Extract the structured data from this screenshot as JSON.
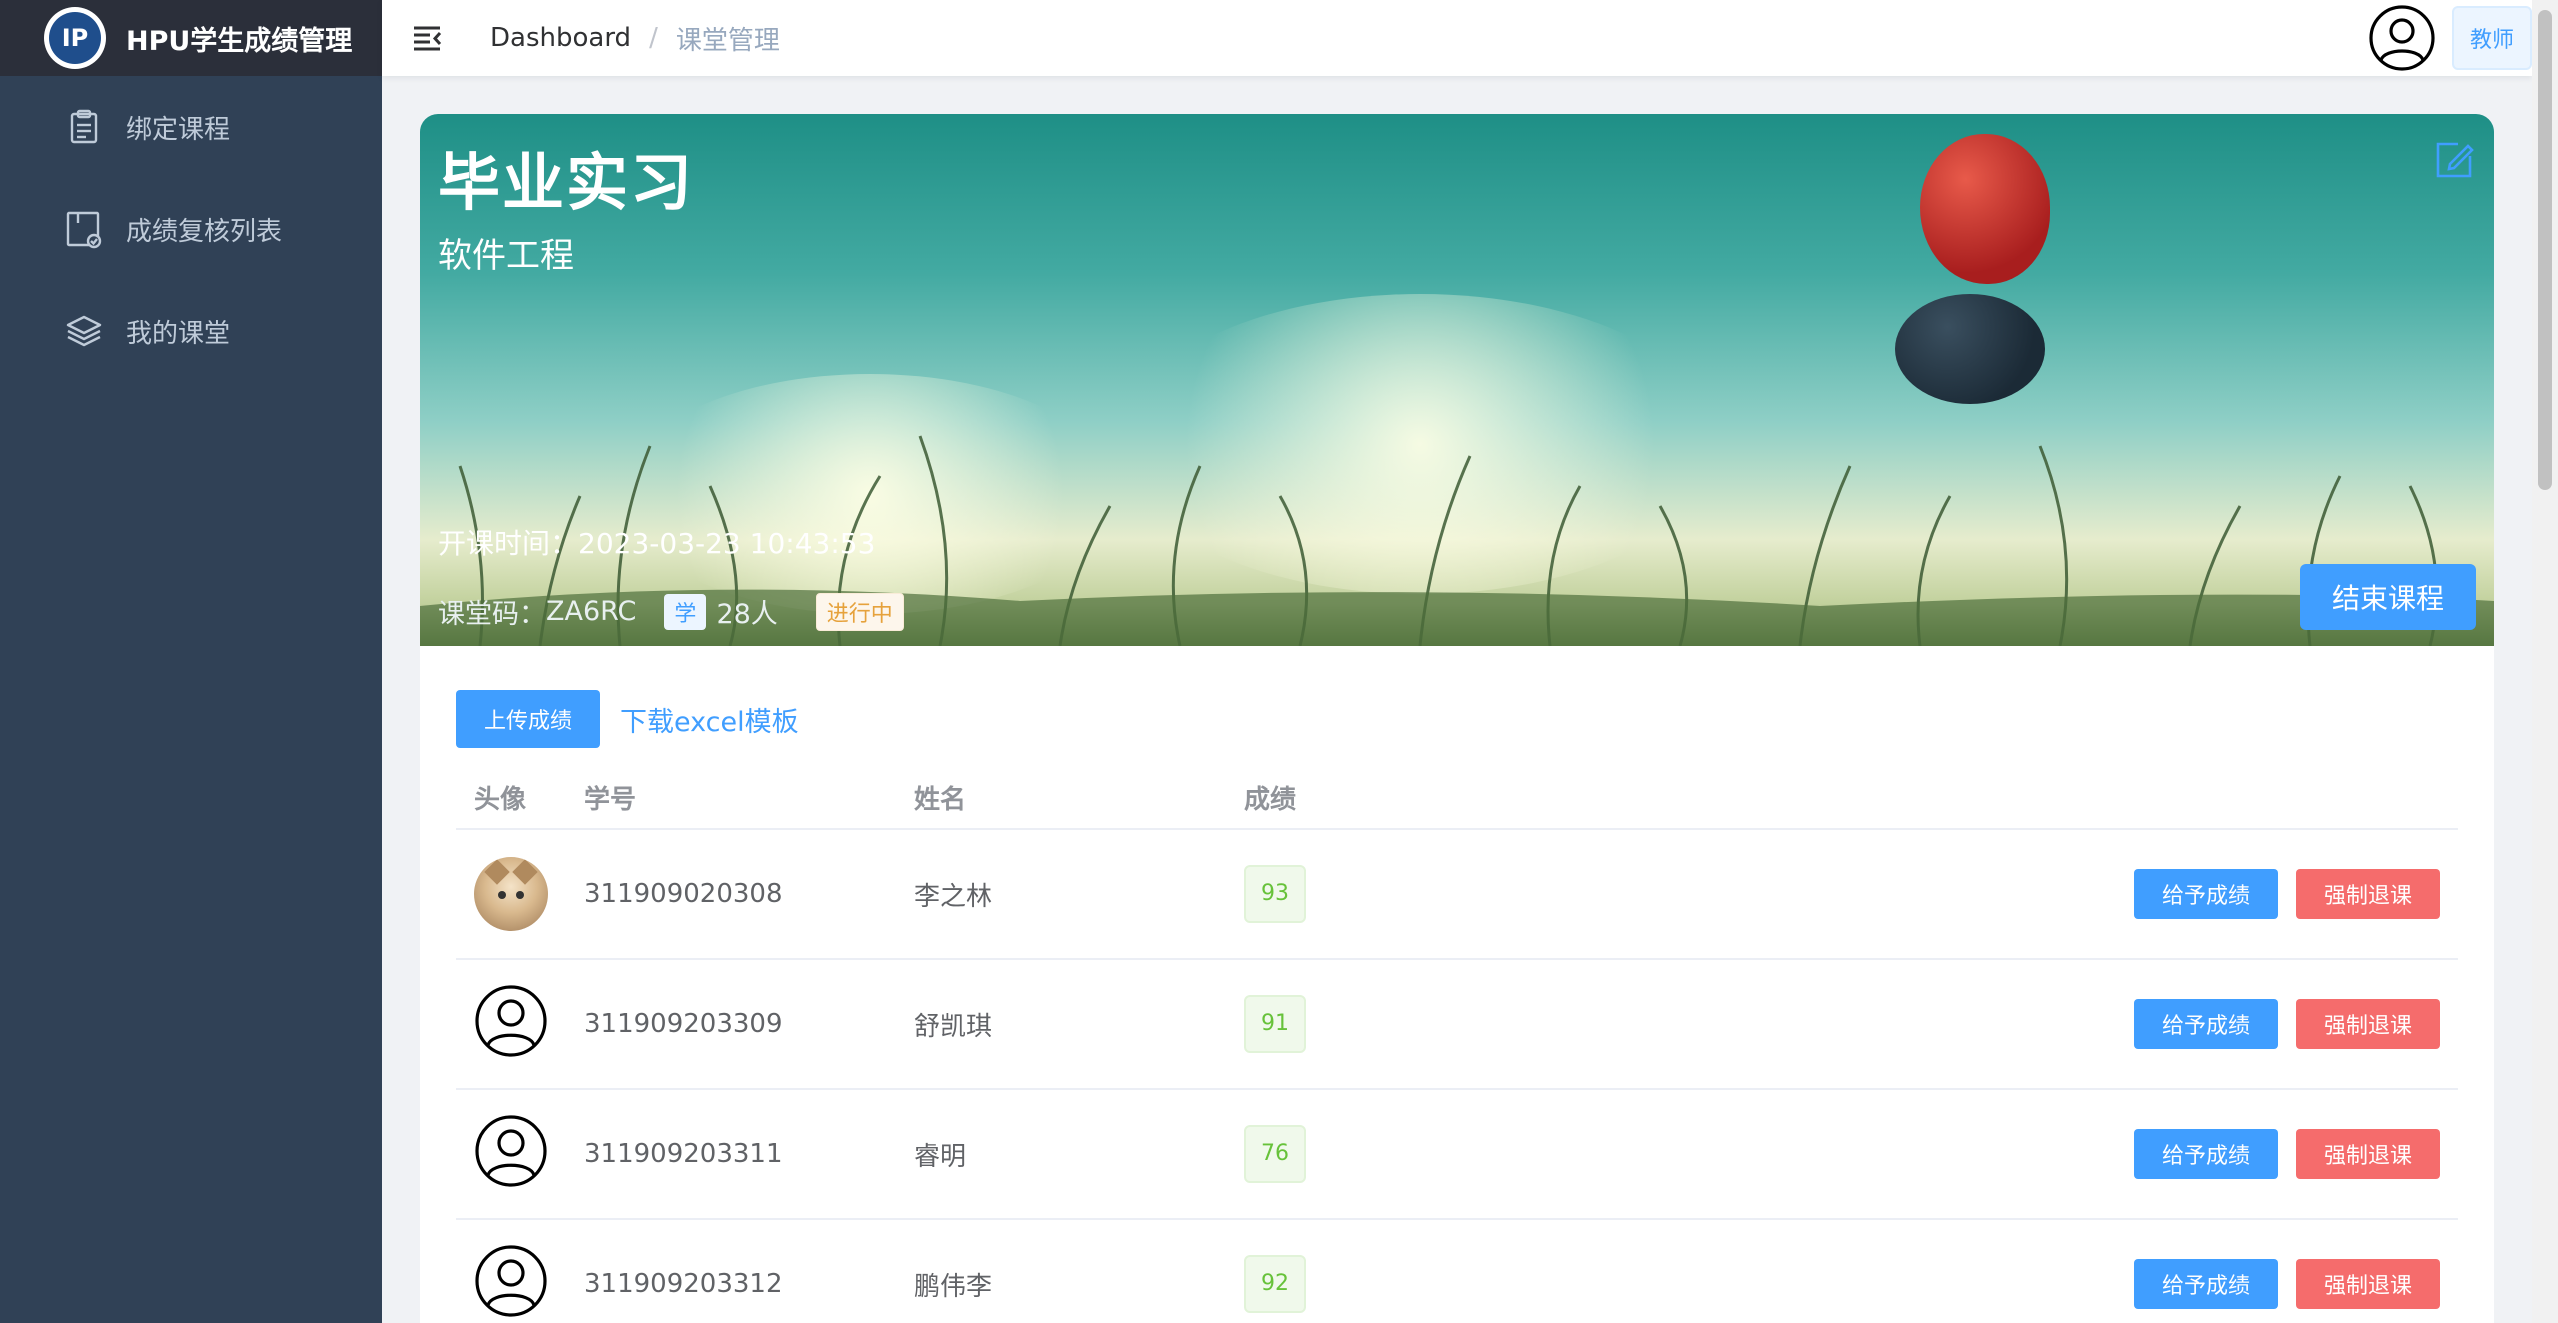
{
  "brand": {
    "title": "HPU学生成绩管理",
    "logo_text": "IP"
  },
  "sidebar": {
    "items": [
      {
        "label": "绑定课程",
        "icon": "clipboard-icon"
      },
      {
        "label": "成绩复核列表",
        "icon": "review-icon"
      },
      {
        "label": "我的课堂",
        "icon": "classroom-icon"
      }
    ]
  },
  "header": {
    "breadcrumb": [
      "Dashboard",
      "课堂管理"
    ],
    "separator": "/",
    "role": "教师"
  },
  "course": {
    "title": "毕业实习",
    "major": "软件工程",
    "start_label": "开课时间：",
    "start_time": "2023-03-23 10:43:53",
    "code_label": "课堂码：",
    "code": "ZA6RC",
    "student_tag": "学",
    "student_count": "28人",
    "status": "进行中",
    "end_button": "结束课程"
  },
  "toolbar": {
    "upload_label": "上传成绩",
    "template_link": "下载excel模板"
  },
  "table": {
    "headers": [
      "头像",
      "学号",
      "姓名",
      "成绩"
    ],
    "rows": [
      {
        "id": "311909020308",
        "name": "李之林",
        "score": "93",
        "avatar": "photo"
      },
      {
        "id": "311909203309",
        "name": "舒凯琪",
        "score": "91",
        "avatar": "default"
      },
      {
        "id": "311909203311",
        "name": "睿明",
        "score": "76",
        "avatar": "default"
      },
      {
        "id": "311909203312",
        "name": "鹏伟李",
        "score": "92",
        "avatar": "default"
      }
    ],
    "grade_button": "给予成绩",
    "drop_button": "强制退课"
  },
  "colors": {
    "sidebar_bg": "#304156",
    "primary": "#409eff",
    "danger": "#f56c6c",
    "success": "#67c23a",
    "warning": "#e6a23c"
  }
}
